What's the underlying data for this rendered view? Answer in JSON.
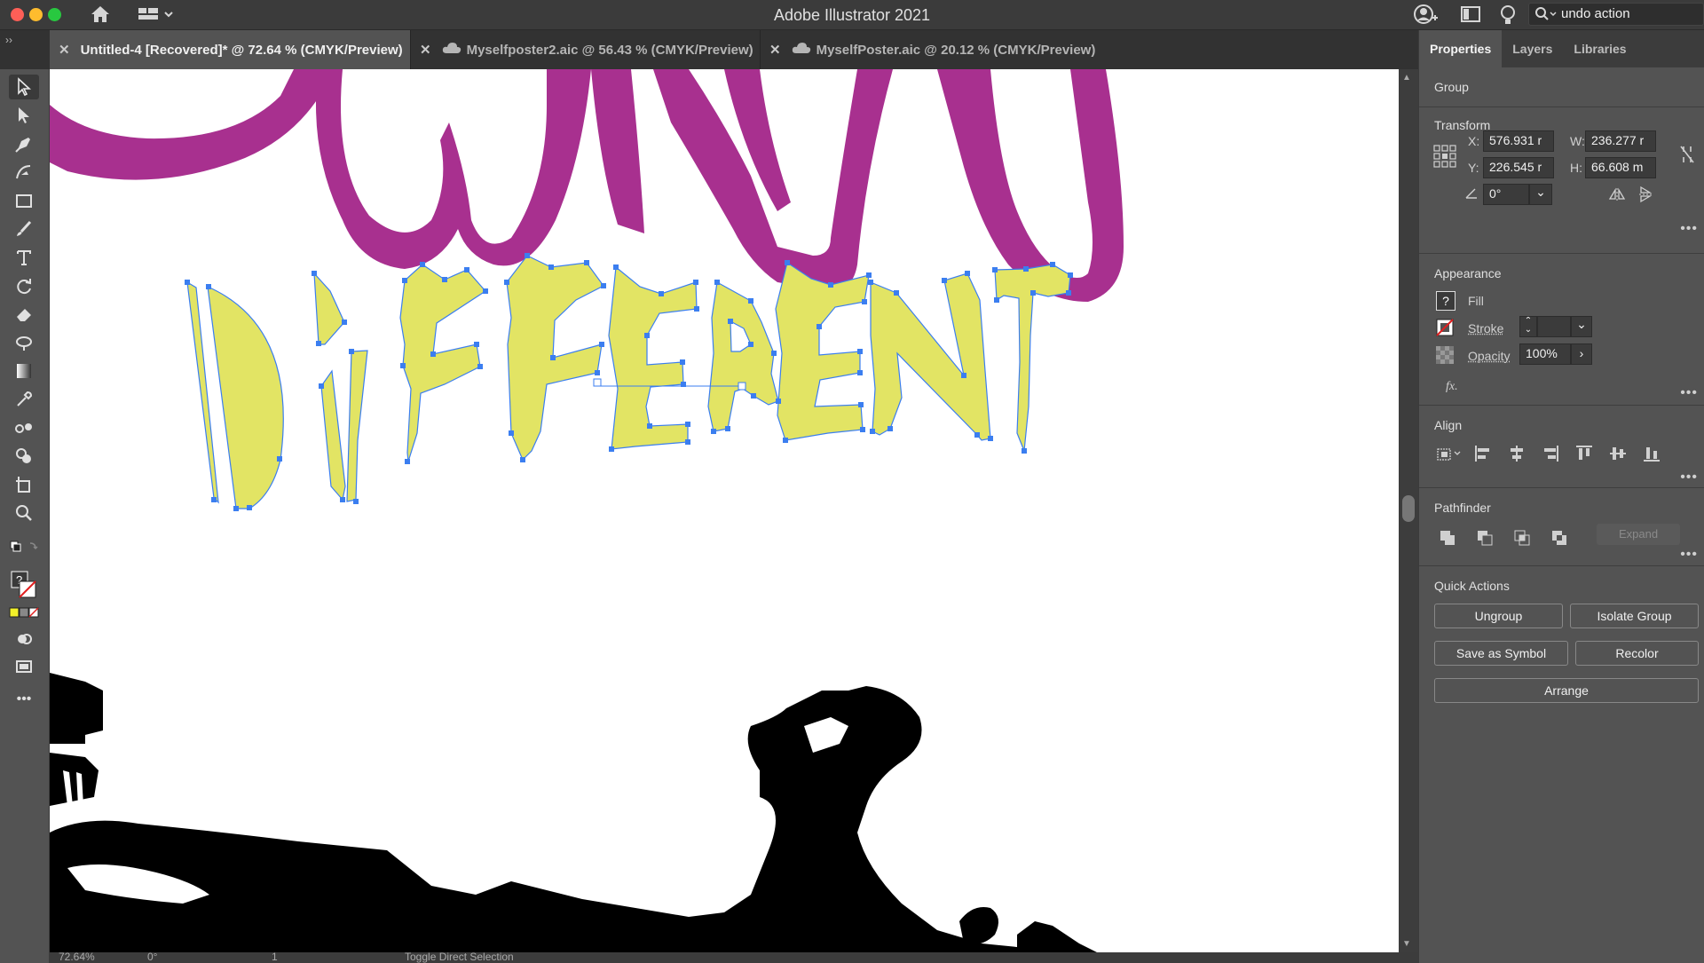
{
  "window": {
    "title": "Adobe Illustrator 2021",
    "search_value": "undo action"
  },
  "tabs": [
    {
      "label": "Untitled-4 [Recovered]* @ 72.64 % (CMYK/Preview)",
      "active": true,
      "cloud": false
    },
    {
      "label": "Myselfposter2.aic @ 56.43 % (CMYK/Preview)",
      "active": false,
      "cloud": true
    },
    {
      "label": "MyselfPoster.aic @ 20.12 % (CMYK/Preview)",
      "active": false,
      "cloud": true
    }
  ],
  "panel": {
    "tabs": [
      "Properties",
      "Layers",
      "Libraries"
    ],
    "selection_type": "Group",
    "transform": {
      "title": "Transform",
      "x_label": "X:",
      "x": "576.931 r",
      "y_label": "Y:",
      "y": "226.545 r",
      "w_label": "W:",
      "w": "236.277 r",
      "h_label": "H:",
      "h": "66.608 m",
      "rotation": "0°"
    },
    "appearance": {
      "title": "Appearance",
      "fill_label": "Fill",
      "stroke_label": "Stroke",
      "opacity_label": "Opacity",
      "opacity": "100%",
      "fx_label": "fx."
    },
    "align": {
      "title": "Align"
    },
    "pathfinder": {
      "title": "Pathfinder",
      "expand_label": "Expand"
    },
    "quick_actions": {
      "title": "Quick Actions",
      "ungroup": "Ungroup",
      "isolate_group": "Isolate Group",
      "save_as_symbol": "Save as Symbol",
      "recolor": "Recolor",
      "arrange": "Arrange"
    }
  },
  "status": {
    "zoom": "72.64%",
    "rotation": "0°",
    "artboard": "1",
    "tool_hint": "Toggle Direct Selection"
  },
  "colors": {
    "magenta": "#a8308f",
    "yellow": "#e2e464",
    "selection": "#3b7ef0",
    "close_red": "#fe5f57",
    "min_yellow": "#febc2e",
    "max_green": "#28c840"
  }
}
